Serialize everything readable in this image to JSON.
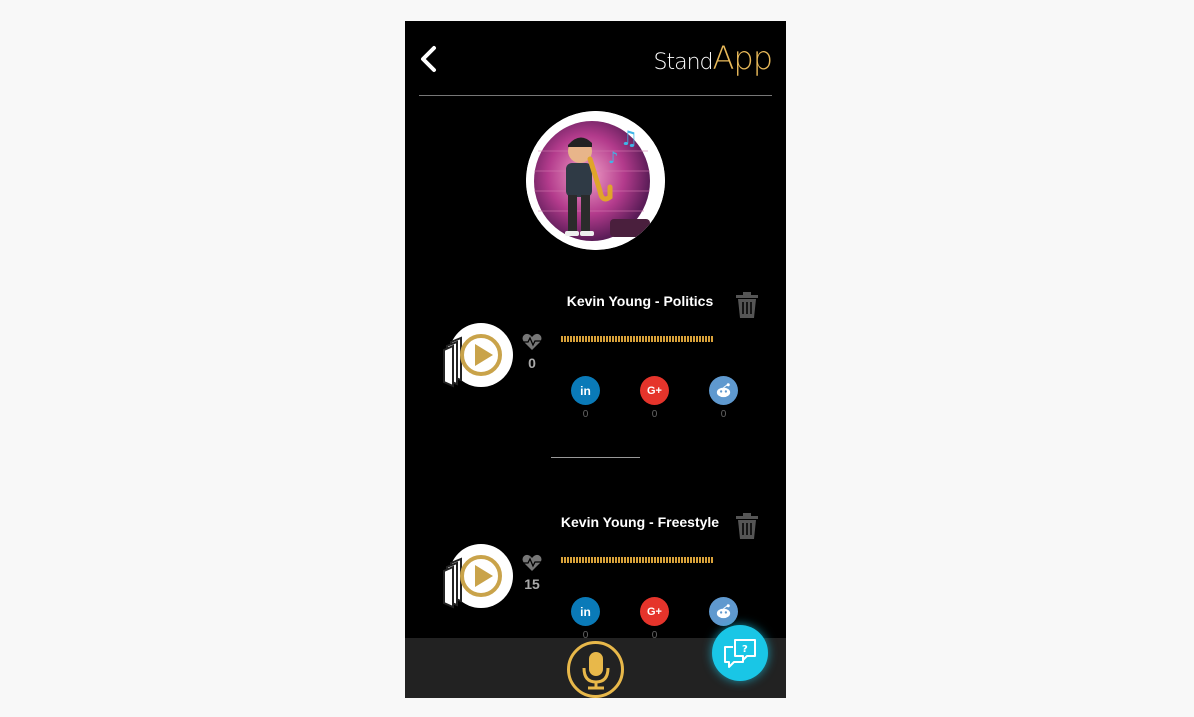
{
  "header": {
    "logo_stand": "Stand",
    "logo_app": "App",
    "back_icon": "chevron-left-icon"
  },
  "profile": {
    "avatar_icon": "saxophone-player-avatar"
  },
  "tracks": [
    {
      "title": "Kevin Young - Politics",
      "likes": "0",
      "shares": {
        "linkedin": "0",
        "googleplus": "0",
        "reddit": "0"
      }
    },
    {
      "title": "Kevin Young - Freestyle",
      "likes": "15",
      "shares": {
        "linkedin": "0",
        "googleplus": "0",
        "reddit": "0"
      }
    }
  ],
  "share_labels": {
    "linkedin": "in",
    "googleplus": "G+"
  },
  "colors": {
    "accent": "#e8b95a",
    "waveform": "#d9a23a",
    "linkedin": "#0a7ab8",
    "googleplus": "#e5342b",
    "reddit": "#5f99cf",
    "chat": "#19c6e6"
  },
  "bottom_bar": {
    "mic_icon": "microphone-icon",
    "chat_icon": "chat-help-icon"
  }
}
